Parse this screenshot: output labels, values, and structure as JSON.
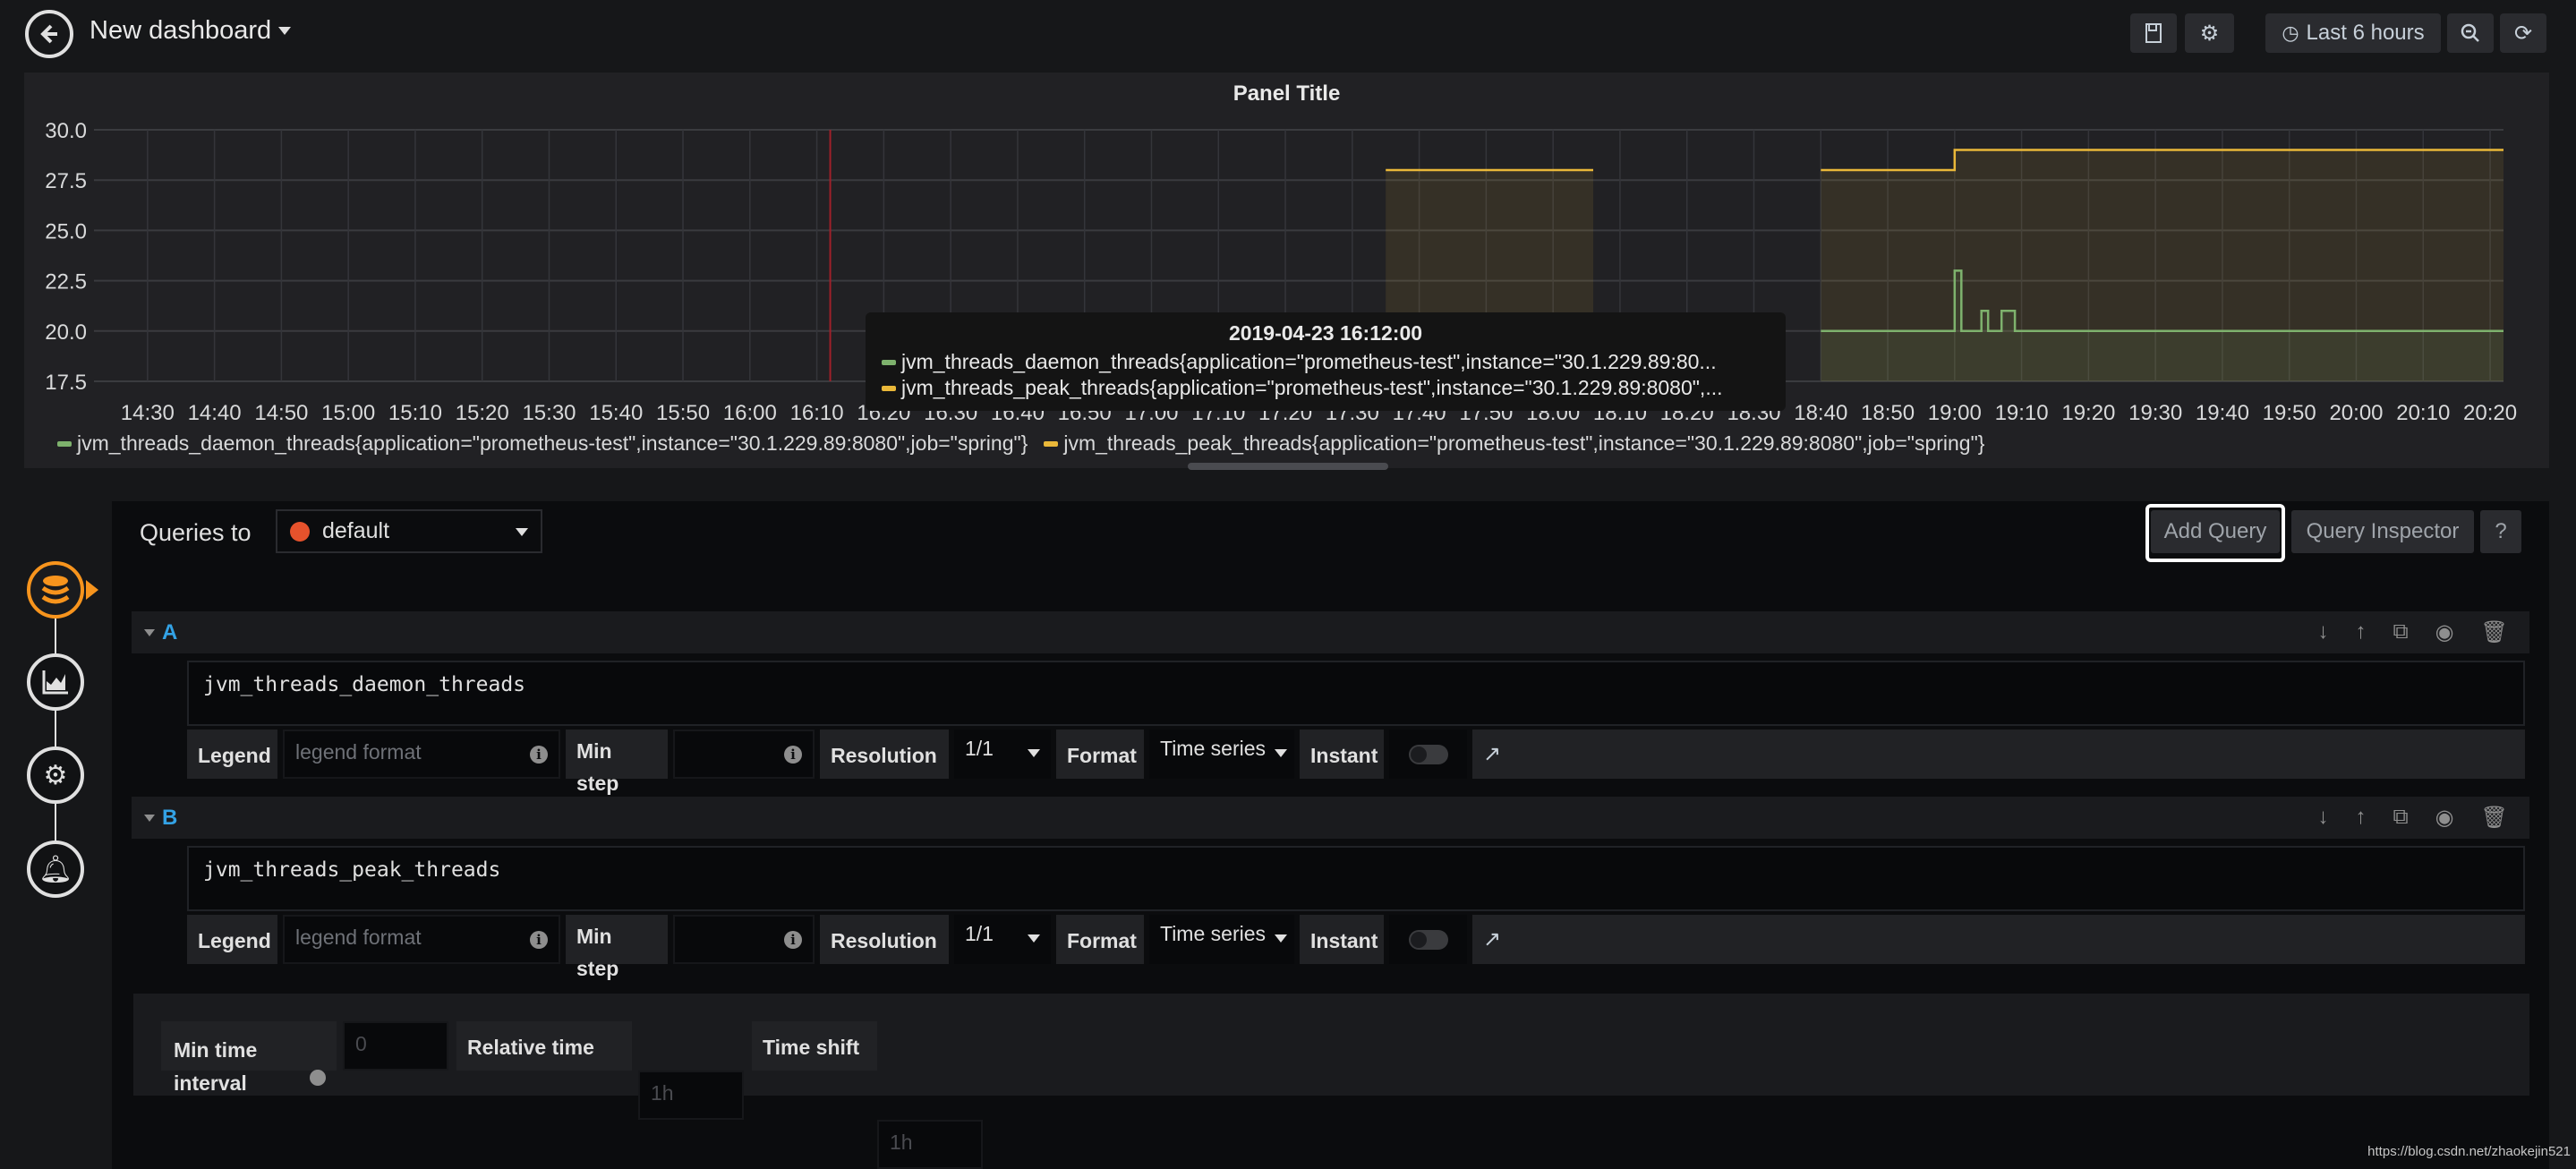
{
  "header": {
    "title": "New dashboard",
    "time_range": "Last 6 hours",
    "icons": [
      "back-arrow-icon",
      "save-icon",
      "gear-icon",
      "clock-icon",
      "zoom-out-icon",
      "refresh-icon"
    ]
  },
  "panel": {
    "title": "Panel Title",
    "tooltip": {
      "time": "2019-04-23 16:12:00",
      "rows": [
        "jvm_threads_daemon_threads{application=\"prometheus-test\",instance=\"30.1.229.89:80...",
        "jvm_threads_peak_threads{application=\"prometheus-test\",instance=\"30.1.229.89:8080\",..."
      ]
    }
  },
  "chart_data": {
    "type": "line",
    "title": "Panel Title",
    "xlabel": "",
    "ylabel": "",
    "xlim": [
      "14:22",
      "20:22"
    ],
    "ylim": [
      17.5,
      30.0
    ],
    "grid": true,
    "legend_placement": "bottom-left",
    "y_ticks": [
      "30.0",
      "27.5",
      "25.0",
      "22.5",
      "20.0",
      "17.5"
    ],
    "x_ticks": [
      "14:30",
      "14:40",
      "14:50",
      "15:00",
      "15:10",
      "15:20",
      "15:30",
      "15:40",
      "15:50",
      "16:00",
      "16:10",
      "16:20",
      "16:30",
      "16:40",
      "16:50",
      "17:00",
      "17:10",
      "17:20",
      "17:30",
      "17:40",
      "17:50",
      "18:00",
      "18:10",
      "18:20",
      "18:30",
      "18:40",
      "18:50",
      "19:00",
      "19:10",
      "19:20",
      "19:30",
      "19:40",
      "19:50",
      "20:00",
      "20:10",
      "20:20"
    ],
    "hover_time": "16:12",
    "series": [
      {
        "name": "jvm_threads_daemon_threads{application=\"prometheus-test\",instance=\"30.1.229.89:8080\",job=\"spring\"}",
        "color": "#7eb26d",
        "segments": [
          [
            [
              "17:35",
              20
            ],
            [
              "18:06",
              20
            ]
          ],
          [
            [
              "18:40",
              20
            ],
            [
              "19:00",
              20
            ],
            [
              "19:00",
              23
            ],
            [
              "19:01",
              23
            ],
            [
              "19:01",
              20
            ],
            [
              "19:04",
              20
            ],
            [
              "19:04",
              21
            ],
            [
              "19:05",
              21
            ],
            [
              "19:05",
              20
            ],
            [
              "19:07",
              20
            ],
            [
              "19:07",
              21
            ],
            [
              "19:09",
              21
            ],
            [
              "19:09",
              20
            ],
            [
              "20:22",
              20
            ]
          ]
        ]
      },
      {
        "name": "jvm_threads_peak_threads{application=\"prometheus-test\",instance=\"30.1.229.89:8080\",job=\"spring\"}",
        "color": "#eab839",
        "segments": [
          [
            [
              "17:35",
              28
            ],
            [
              "18:06",
              28
            ]
          ],
          [
            [
              "18:40",
              28
            ],
            [
              "19:00",
              28
            ],
            [
              "19:00",
              29
            ],
            [
              "20:22",
              29
            ]
          ]
        ]
      }
    ]
  },
  "editor": {
    "queries_to_label": "Queries to",
    "datasource": "default",
    "add_query": "Add Query",
    "query_inspector": "Query Inspector",
    "help": "?",
    "queries": [
      {
        "ref": "A",
        "expr": "jvm_threads_daemon_threads",
        "legend_label": "Legend",
        "legend_placeholder": "legend format",
        "min_step_label": "Min step",
        "resolution_label": "Resolution",
        "resolution": "1/1",
        "format_label": "Format",
        "format": "Time series",
        "instant_label": "Instant",
        "instant": false
      },
      {
        "ref": "B",
        "expr": "jvm_threads_peak_threads",
        "legend_label": "Legend",
        "legend_placeholder": "legend format",
        "min_step_label": "Min step",
        "resolution_label": "Resolution",
        "resolution": "1/1",
        "format_label": "Format",
        "format": "Time series",
        "instant_label": "Instant",
        "instant": false
      }
    ],
    "options": {
      "min_time_interval_label": "Min time interval",
      "min_time_interval_placeholder": "0",
      "relative_time_label": "Relative time",
      "relative_time_placeholder": "1h",
      "time_shift_label": "Time shift",
      "time_shift_placeholder": "1h"
    }
  },
  "watermark": "https://blog.csdn.net/zhaokejin521"
}
